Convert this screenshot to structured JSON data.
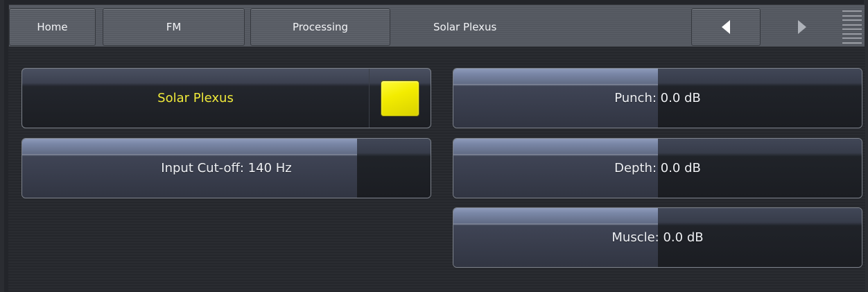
{
  "nav": {
    "tabs": [
      {
        "label": "Home"
      },
      {
        "label": "FM"
      },
      {
        "label": "Processing"
      }
    ],
    "current": "Solar Plexus"
  },
  "controls": {
    "solar_plexus": {
      "label": "Solar Plexus",
      "active": true,
      "led_color": "#f4ee00",
      "label_color": "#f0ea3a"
    },
    "input_cutoff": {
      "label": "Input Cut-off: 140 Hz",
      "level": 0.82
    },
    "punch": {
      "label": "Punch: 0.0 dB",
      "level": 0.5
    },
    "depth": {
      "label": "Depth: 0.0 dB",
      "level": 0.5
    },
    "muscle": {
      "label": "Muscle: 0.0 dB",
      "level": 0.5
    }
  },
  "icons": {
    "back": "left-triangle-icon",
    "forward": "right-triangle-icon",
    "menu": "hamburger-menu-icon"
  }
}
